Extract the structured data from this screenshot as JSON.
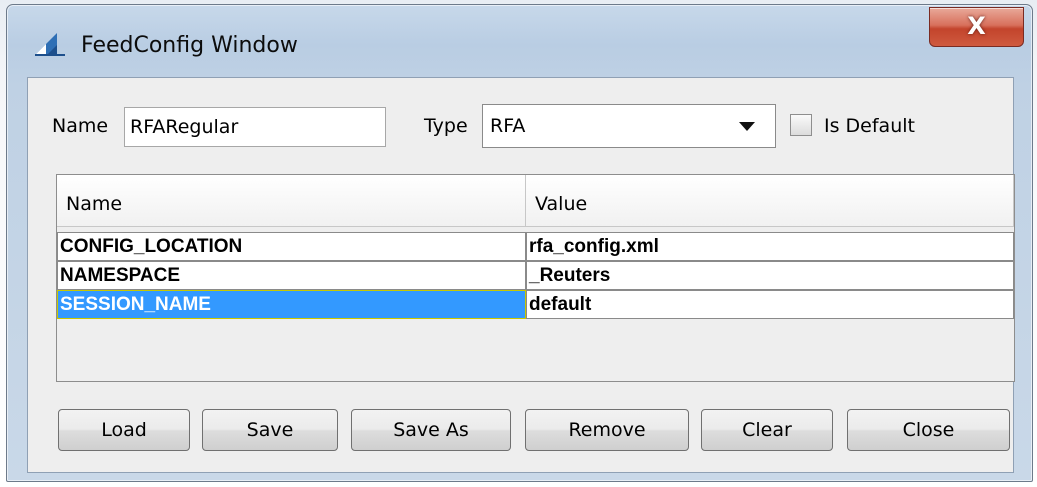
{
  "window": {
    "title": "FeedConfig Window",
    "close_glyph": "X"
  },
  "form": {
    "name_label": "Name",
    "name_value": "RFARegular",
    "type_label": "Type",
    "type_value": "RFA",
    "is_default_label": "Is Default",
    "is_default_checked": false
  },
  "table": {
    "columns": [
      "Name",
      "Value"
    ],
    "rows": [
      {
        "name": "CONFIG_LOCATION",
        "value": "rfa_config.xml",
        "selected": false
      },
      {
        "name": "NAMESPACE",
        "value": "_Reuters",
        "selected": false
      },
      {
        "name": "SESSION_NAME",
        "value": "default",
        "selected": true
      }
    ]
  },
  "buttons": [
    "Load",
    "Save",
    "Save As",
    "Remove",
    "Clear",
    "Close"
  ],
  "colors": {
    "selection": "#3399ff",
    "close_button": "#c3442c"
  }
}
